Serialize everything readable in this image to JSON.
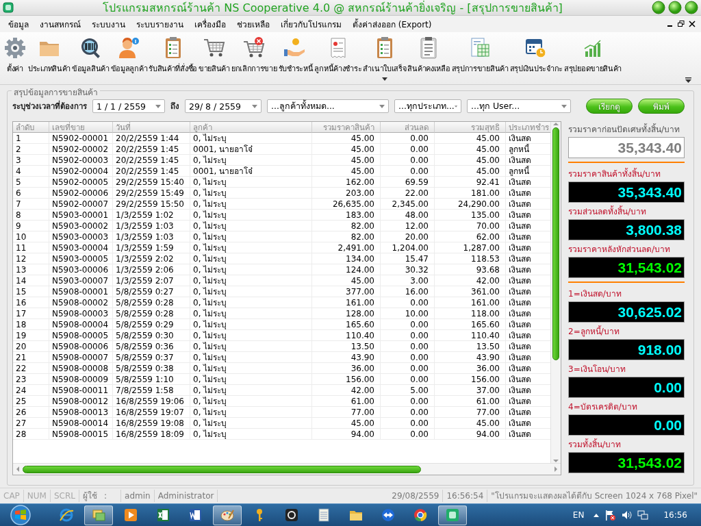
{
  "window": {
    "title": "โปรแกรมสหกรณ์ร้านค้า NS Cooperative 4.0 @ สหกรณ์ร้านค้ายิ่งเจริญ - [สรุปการขายสินค้า]"
  },
  "menu": [
    "ข้อมูล",
    "งานสหกรณ์",
    "ระบบงาน",
    "ระบบรายงาน",
    "เครื่องมือ",
    "ช่วยเหลือ",
    "เกี่ยวกับโปรแกรม",
    "ตั้งค่าส่งออก (Export)"
  ],
  "toolbar": [
    {
      "label": "ตั้งค่า",
      "dropdown": false
    },
    {
      "label": "ประเภทสินค้า",
      "dropdown": false
    },
    {
      "label": "ข้อมูลสินค้า",
      "dropdown": false
    },
    {
      "label": "ข้อมูลลูกค้า",
      "dropdown": false
    },
    {
      "label": "รับสินค้าที่สั่งซื้อ",
      "dropdown": false
    },
    {
      "label": "ขายสินค้า",
      "dropdown": false
    },
    {
      "label": "ยกเลิกการขาย",
      "dropdown": false
    },
    {
      "label": "รับชำระหนี้",
      "dropdown": false
    },
    {
      "label": "ลูกหนี้ค้างชำระ",
      "dropdown": false
    },
    {
      "label": "สำเนาใบเสร็จ",
      "dropdown": true
    },
    {
      "label": "สินค้าคงเหลือ",
      "dropdown": false
    },
    {
      "label": "สรุปการขายสินค้า",
      "dropdown": false
    },
    {
      "label": "สรุปเงินประจำกะ",
      "dropdown": false
    },
    {
      "label": "สรุปยอดขายสินค้า",
      "dropdown": false
    }
  ],
  "filter": {
    "group_title": "สรุปข้อมูลการขายสินค้า",
    "range_label": "ระบุช่วงเวลาที่ต้องการ",
    "date_from": "1 / 1 / 2559",
    "to_label": "ถึง",
    "date_to": "29/ 8 / 2559",
    "customer": "...ลูกค้าทั้งหมด...",
    "payment_type": "...ทุกประเภท...",
    "user": "...ทุก User...",
    "buttons": [
      "เรียกดู",
      "พิมพ์"
    ]
  },
  "table": {
    "columns": [
      "ลำดับ",
      "เลขที่ขาย",
      "วันที่",
      "ลูกค้า",
      "รวมราคาสินค้า",
      "ส่วนลด",
      "รวมสุทธิ",
      "ประเภทชำร"
    ],
    "rows": [
      [
        "1",
        "N5902-00001",
        "20/2/2559 1:44",
        "0, ไม่ระบุ",
        "45.00",
        "0.00",
        "45.00",
        "เงินสด"
      ],
      [
        "2",
        "N5902-00002",
        "20/2/2559 1:45",
        "0001, นายอาโจ๋",
        "45.00",
        "0.00",
        "45.00",
        "ลูกหนี้"
      ],
      [
        "3",
        "N5902-00003",
        "20/2/2559 1:45",
        "0, ไม่ระบุ",
        "45.00",
        "0.00",
        "45.00",
        "เงินสด"
      ],
      [
        "4",
        "N5902-00004",
        "20/2/2559 1:45",
        "0001, นายอาโจ๋",
        "45.00",
        "0.00",
        "45.00",
        "ลูกหนี้"
      ],
      [
        "5",
        "N5902-00005",
        "29/2/2559 15:40",
        "0, ไม่ระบุ",
        "162.00",
        "69.59",
        "92.41",
        "เงินสด"
      ],
      [
        "6",
        "N5902-00006",
        "29/2/2559 15:49",
        "0, ไม่ระบุ",
        "203.00",
        "22.00",
        "181.00",
        "เงินสด"
      ],
      [
        "7",
        "N5902-00007",
        "29/2/2559 15:50",
        "0, ไม่ระบุ",
        "26,635.00",
        "2,345.00",
        "24,290.00",
        "เงินสด"
      ],
      [
        "8",
        "N5903-00001",
        "1/3/2559 1:02",
        "0, ไม่ระบุ",
        "183.00",
        "48.00",
        "135.00",
        "เงินสด"
      ],
      [
        "9",
        "N5903-00002",
        "1/3/2559 1:03",
        "0, ไม่ระบุ",
        "82.00",
        "12.00",
        "70.00",
        "เงินสด"
      ],
      [
        "10",
        "N5903-00003",
        "1/3/2559 1:03",
        "0, ไม่ระบุ",
        "82.00",
        "20.00",
        "62.00",
        "เงินสด"
      ],
      [
        "11",
        "N5903-00004",
        "1/3/2559 1:59",
        "0, ไม่ระบุ",
        "2,491.00",
        "1,204.00",
        "1,287.00",
        "เงินสด"
      ],
      [
        "12",
        "N5903-00005",
        "1/3/2559 2:02",
        "0, ไม่ระบุ",
        "134.00",
        "15.47",
        "118.53",
        "เงินสด"
      ],
      [
        "13",
        "N5903-00006",
        "1/3/2559 2:06",
        "0, ไม่ระบุ",
        "124.00",
        "30.32",
        "93.68",
        "เงินสด"
      ],
      [
        "14",
        "N5903-00007",
        "1/3/2559 2:07",
        "0, ไม่ระบุ",
        "45.00",
        "3.00",
        "42.00",
        "เงินสด"
      ],
      [
        "15",
        "N5908-00001",
        "5/8/2559 0:27",
        "0, ไม่ระบุ",
        "377.00",
        "16.00",
        "361.00",
        "เงินสด"
      ],
      [
        "16",
        "N5908-00002",
        "5/8/2559 0:28",
        "0, ไม่ระบุ",
        "161.00",
        "0.00",
        "161.00",
        "เงินสด"
      ],
      [
        "17",
        "N5908-00003",
        "5/8/2559 0:28",
        "0, ไม่ระบุ",
        "128.00",
        "10.00",
        "118.00",
        "เงินสด"
      ],
      [
        "18",
        "N5908-00004",
        "5/8/2559 0:29",
        "0, ไม่ระบุ",
        "165.60",
        "0.00",
        "165.60",
        "เงินสด"
      ],
      [
        "19",
        "N5908-00005",
        "5/8/2559 0:30",
        "0, ไม่ระบุ",
        "110.40",
        "0.00",
        "110.40",
        "เงินสด"
      ],
      [
        "20",
        "N5908-00006",
        "5/8/2559 0:36",
        "0, ไม่ระบุ",
        "13.50",
        "0.00",
        "13.50",
        "เงินสด"
      ],
      [
        "21",
        "N5908-00007",
        "5/8/2559 0:37",
        "0, ไม่ระบุ",
        "43.90",
        "0.00",
        "43.90",
        "เงินสด"
      ],
      [
        "22",
        "N5908-00008",
        "5/8/2559 0:38",
        "0, ไม่ระบุ",
        "36.00",
        "0.00",
        "36.00",
        "เงินสด"
      ],
      [
        "23",
        "N5908-00009",
        "5/8/2559 1:10",
        "0, ไม่ระบุ",
        "156.00",
        "0.00",
        "156.00",
        "เงินสด"
      ],
      [
        "24",
        "N5908-00011",
        "7/8/2559 1:58",
        "0, ไม่ระบุ",
        "42.00",
        "5.00",
        "37.00",
        "เงินสด"
      ],
      [
        "25",
        "N5908-00012",
        "16/8/2559 19:06",
        "0, ไม่ระบุ",
        "61.00",
        "0.00",
        "61.00",
        "เงินสด"
      ],
      [
        "26",
        "N5908-00013",
        "16/8/2559 19:07",
        "0, ไม่ระบุ",
        "77.00",
        "0.00",
        "77.00",
        "เงินสด"
      ],
      [
        "27",
        "N5908-00014",
        "16/8/2559 19:08",
        "0, ไม่ระบุ",
        "45.00",
        "0.00",
        "45.00",
        "เงินสด"
      ],
      [
        "28",
        "N5908-00015",
        "16/8/2559 18:09",
        "0, ไม่ระบุ",
        "94.00",
        "0.00",
        "94.00",
        "เงินสด"
      ]
    ]
  },
  "summary": {
    "groups": [
      {
        "items": [
          {
            "label": "รวมราคาก่อนปัดเศษทั้งสิ้น/บาท",
            "value": "35,343.40",
            "kind": "plain",
            "color": "#7f7f7f"
          }
        ]
      },
      {
        "items": [
          {
            "label": "รวมราคาสินค้าทั้งสิ้น/บาท",
            "value": "35,343.40",
            "kind": "display",
            "color": "#00ffff"
          },
          {
            "label": "รวมส่วนลดทั้งสิ้น/บาท",
            "value": "3,800.38",
            "kind": "display",
            "color": "#00ffff"
          },
          {
            "label": "รวมราคาหลังหักส่วนลด/บาท",
            "value": "31,543.02",
            "kind": "display",
            "color": "#00ff00"
          }
        ]
      },
      {
        "items": [
          {
            "label": "1=เงินสด/บาท",
            "value": "30,625.02",
            "kind": "display",
            "color": "#00ffff"
          },
          {
            "label": "2=ลูกหนี้/บาท",
            "value": "918.00",
            "kind": "display",
            "color": "#00ffff"
          },
          {
            "label": "3=เงินโอน/บาท",
            "value": "0.00",
            "kind": "display",
            "color": "#00ffff"
          },
          {
            "label": "4=บัตรเครดิต/บาท",
            "value": "0.00",
            "kind": "display",
            "color": "#00ffff"
          },
          {
            "label": "รวมทั้งสิ้น/บาท",
            "value": "31,543.02",
            "kind": "display",
            "color": "#00ff00"
          }
        ]
      }
    ]
  },
  "status_bar": {
    "indicators": [
      {
        "label": "CAP",
        "on": false
      },
      {
        "label": "NUM",
        "on": false
      },
      {
        "label": "SCRL",
        "on": false
      }
    ],
    "user_label": "ผู้ใช้",
    "separator": ":",
    "user": "admin",
    "role": "Administrator",
    "date": "29/08/2559",
    "time": "16:56:54",
    "message": "\"โปรแกรมจะแสดงผลได้ดีกับ  Screen 1024 x 768 Pixel\""
  },
  "taskbar": {
    "apps": [
      {
        "active": false
      },
      {
        "active": true
      },
      {
        "active": false
      },
      {
        "active": false
      },
      {
        "active": false
      },
      {
        "active": true
      },
      {
        "active": false
      },
      {
        "active": false
      },
      {
        "active": false
      },
      {
        "active": false
      },
      {
        "active": false
      },
      {
        "active": false
      },
      {
        "active": true
      }
    ],
    "language": "EN",
    "clock": "16:56"
  }
}
